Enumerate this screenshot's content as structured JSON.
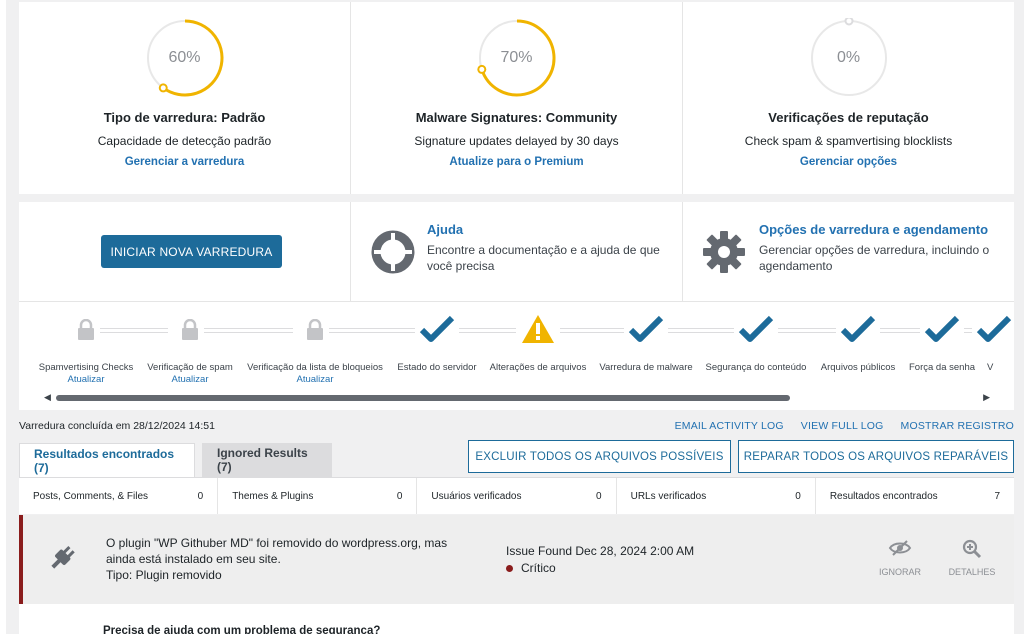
{
  "summary_cards": [
    {
      "percent": 60,
      "percent_label": "60%",
      "title": "Tipo de varredura: Padrão",
      "subtitle": "Capacidade de detecção padrão",
      "link": "Gerenciar a varredura"
    },
    {
      "percent": 70,
      "percent_label": "70%",
      "title": "Malware Signatures: Community",
      "subtitle": "Signature updates delayed by 30 days",
      "link": "Atualize para o Premium"
    },
    {
      "percent": 0,
      "percent_label": "0%",
      "title": "Verificações de reputação",
      "subtitle": "Check spam & spamvertising blocklists",
      "link": "Gerenciar opções"
    }
  ],
  "actions": {
    "start_scan": "INICIAR NOVA VARREDURA",
    "help_title": "Ajuda",
    "help_desc": "Encontre a documentação e a ajuda de que você precisa",
    "options_title": "Opções de varredura e agendamento",
    "options_desc": "Gerenciar opções de varredura, incluindo o agendamento"
  },
  "steps": [
    {
      "label": "Spamvertising Checks",
      "status": "locked",
      "update": "Atualizar"
    },
    {
      "label": "Verificação de spam",
      "status": "locked",
      "update": "Atualizar"
    },
    {
      "label": "Verificação da lista de bloqueios",
      "status": "locked",
      "update": "Atualizar"
    },
    {
      "label": "Estado do servidor",
      "status": "ok"
    },
    {
      "label": "Alterações de arquivos",
      "status": "warning"
    },
    {
      "label": "Varredura de malware",
      "status": "ok"
    },
    {
      "label": "Segurança do conteúdo",
      "status": "ok"
    },
    {
      "label": "Arquivos públicos",
      "status": "ok"
    },
    {
      "label": "Força da senha",
      "status": "ok"
    },
    {
      "label": "V",
      "status": "partial"
    }
  ],
  "scan_meta": {
    "completed": "Varredura concluída em 28/12/2024 14:51"
  },
  "log_links": [
    "EMAIL ACTIVITY LOG",
    "VIEW FULL LOG",
    "MOSTRAR REGISTRO"
  ],
  "tabs": [
    {
      "label": "Resultados encontrados (7)",
      "active": true
    },
    {
      "label": "Ignored Results (7)",
      "active": false
    }
  ],
  "bulk_buttons": {
    "delete": "EXCLUIR TODOS OS ARQUIVOS POSSÍVEIS",
    "repair": "REPARAR TODOS OS ARQUIVOS REPARÁVEIS"
  },
  "counts": [
    {
      "label": "Posts, Comments, & Files",
      "value": "0"
    },
    {
      "label": "Themes & Plugins",
      "value": "0"
    },
    {
      "label": "Usuários verificados",
      "value": "0"
    },
    {
      "label": "URLs verificados",
      "value": "0"
    },
    {
      "label": "Resultados encontrados",
      "value": "7"
    }
  ],
  "issue": {
    "message": "O plugin \"WP Githuber MD\" foi removido do wordpress.org, mas ainda está instalado em seu site.",
    "type": "Tipo: Plugin removido",
    "found": "Issue Found Dec 28, 2024 2:00 AM",
    "severity": "Crítico",
    "ignore": "IGNORAR",
    "details": "DETALHES"
  },
  "help_banner": "Precisa de ajuda com um problema de segurança?",
  "colors": {
    "accent": "#1d6b9a",
    "gauge": "#f0b400",
    "critical": "#8a1c1c",
    "check": "#1d6b9a",
    "warning": "#f0b400"
  }
}
